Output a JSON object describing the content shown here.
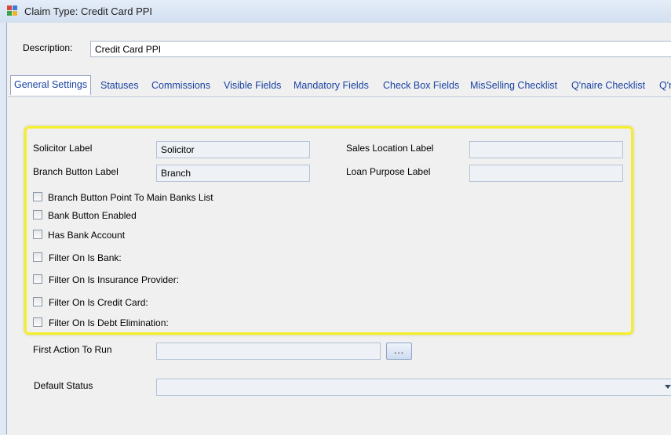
{
  "window": {
    "title": "Claim Type: Credit Card PPI"
  },
  "description": {
    "label": "Description:",
    "value": "Credit Card PPI"
  },
  "tabs": [
    "General Settings",
    "Statuses",
    "Commissions",
    "Visible Fields",
    "Mandatory Fields",
    "Check Box Fields",
    "MisSelling Checklist",
    "Q'naire Checklist",
    "Q'n"
  ],
  "general": {
    "solicitor_label": {
      "label": "Solicitor Label",
      "value": "Solicitor"
    },
    "branch_button_label": {
      "label": "Branch Button Label",
      "value": "Branch"
    },
    "sales_location_label": {
      "label": "Sales Location Label",
      "value": ""
    },
    "loan_purpose_label": {
      "label": "Loan Purpose Label",
      "value": ""
    },
    "checkboxes": [
      {
        "label": "Branch Button Point To Main Banks List",
        "checked": false
      },
      {
        "label": "Bank Button Enabled",
        "checked": false
      },
      {
        "label": "Has Bank Account",
        "checked": false
      },
      {
        "label": "Filter On Is Bank:",
        "checked": false
      },
      {
        "label": "Filter On Is Insurance Provider:",
        "checked": false
      },
      {
        "label": "Filter On Is Credit Card:",
        "checked": false
      },
      {
        "label": "Filter On Is Debt Elimination:",
        "checked": false
      }
    ],
    "first_action": {
      "label": "First Action To Run",
      "value": "",
      "browse_label": "..."
    },
    "default_status": {
      "label": "Default Status",
      "value": ""
    }
  },
  "colors": {
    "highlight": "#f4ef2a",
    "tab_text": "#1a43a3",
    "window_bg": "#f0f0f0"
  }
}
